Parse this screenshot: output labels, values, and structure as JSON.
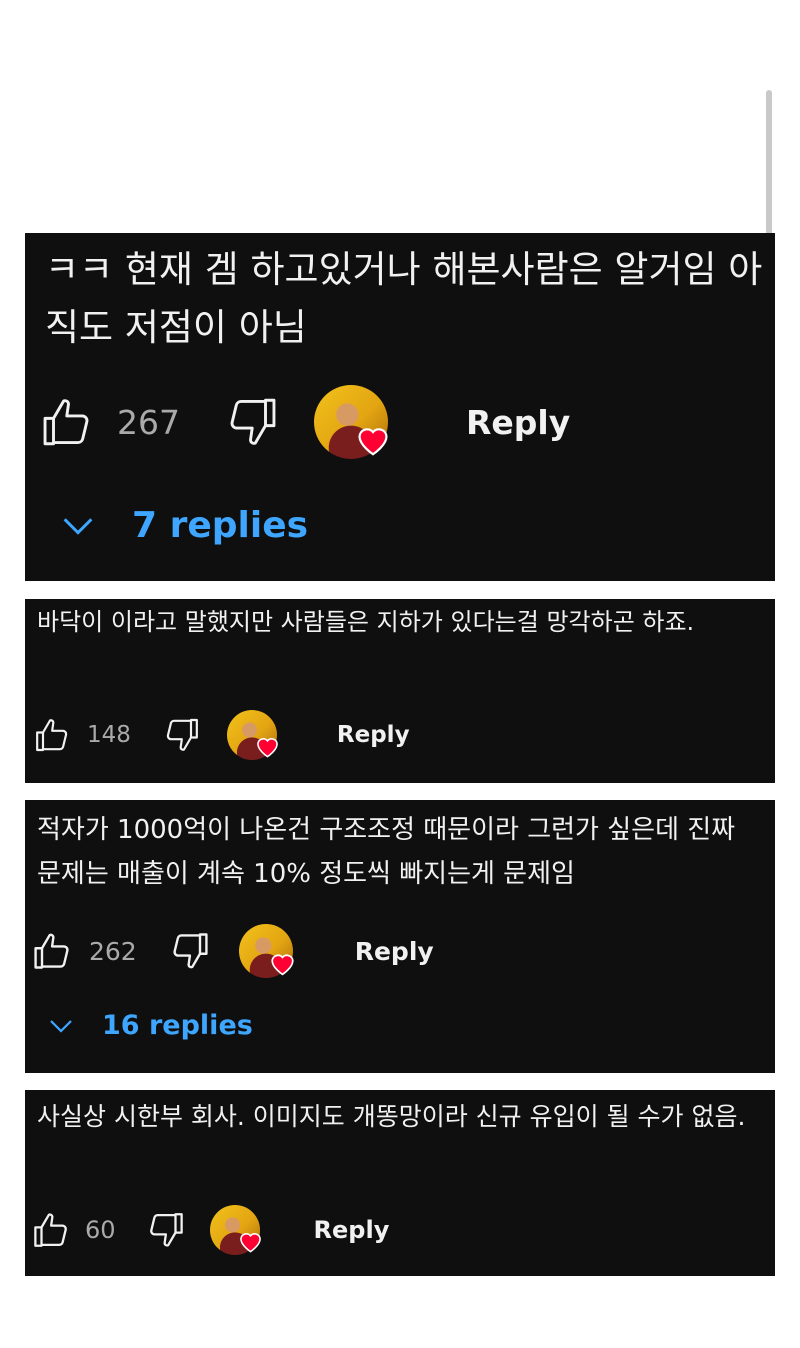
{
  "comments": [
    {
      "text": "ㅋㅋ 현재 겜 하고있거나 해본사람은 알거임 아직도 저점이 아님",
      "likes": "267",
      "reply_label": "Reply",
      "replies_label": "7 replies"
    },
    {
      "text": "바닥이 이라고 말했지만 사람들은 지하가 있다는걸 망각하곤 하죠.",
      "likes": "148",
      "reply_label": "Reply"
    },
    {
      "text": "적자가 1000억이 나온건 구조조정 때문이라 그런가 싶은데 진짜 문제는 매출이 계속 10% 정도씩 빠지는게 문제임",
      "likes": "262",
      "reply_label": "Reply",
      "replies_label": "16 replies"
    },
    {
      "text": "사실상 시한부 회사. 이미지도 개똥망이라 신규 유입이 될 수가 없음.",
      "likes": "60",
      "reply_label": "Reply"
    }
  ],
  "icons": {
    "like": "thumbs-up-icon",
    "dislike": "thumbs-down-icon",
    "heart": "heart-icon",
    "expand": "chevron-down-icon"
  },
  "colors": {
    "background": "#0f0f0f",
    "text": "#f1f1f1",
    "count": "#aaaaaa",
    "replies": "#3ea6ff",
    "heart": "#ff0033"
  }
}
